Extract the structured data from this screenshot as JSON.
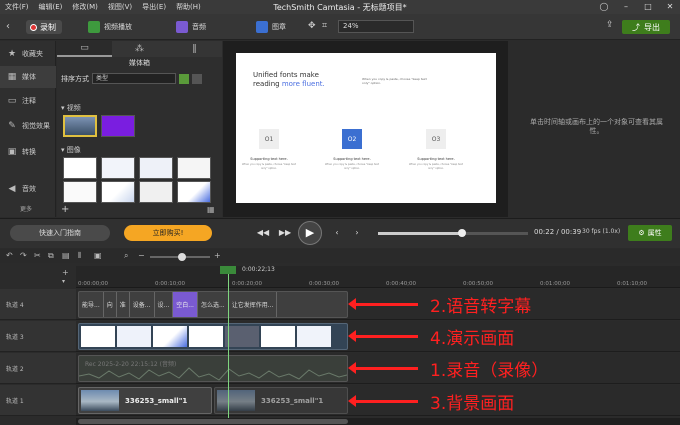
{
  "menubar": {
    "items": [
      "文件(F)",
      "编辑(E)",
      "修改(M)",
      "视图(V)",
      "导出(E)",
      "帮助(H)"
    ],
    "title": "TechSmith Camtasia - 无标题项目*"
  },
  "toolbar": {
    "record_label": "录制",
    "tools": [
      "视频播放",
      "音频",
      "图章"
    ],
    "zoom": "24%",
    "export_label": "导出"
  },
  "sidebar": {
    "items": [
      "收藏夹",
      "媒体",
      "注释",
      "视觉效果",
      "转换",
      "音效"
    ],
    "more_label": "更多"
  },
  "media": {
    "title": "媒体箱",
    "sort_label": "排序方式",
    "sort_value": "类型",
    "video_section": "视频",
    "image_section": "图像"
  },
  "slide": {
    "title_a": "Unified fonts make",
    "title_b": "reading",
    "title_blue": "more fluent.",
    "boxes": [
      "O1",
      "O2",
      "O3"
    ],
    "label": "Supporting text here.",
    "sub": "When you copy & paste, choose \"keep text only\" option."
  },
  "props": {
    "hint": "单击时间轴或画布上的一个对象可查看其属性。"
  },
  "controls": {
    "guide_label": "快速入门指南",
    "buy_label": "立即购买!",
    "time": "00:22 / 00:39",
    "fps": "30 fps (1.0x)",
    "progress": 0.56,
    "props_label": "属性"
  },
  "timeline": {
    "playhead_time": "0:00:22;13",
    "ruler": [
      "0:00:00;00",
      "0:00:10;00",
      "0:00:20;00",
      "0:00:30;00",
      "0:00:40;00",
      "0:00:50;00",
      "0:01:00;00",
      "0:01:10;00"
    ],
    "tracks": [
      "轨道 4",
      "轨道 3",
      "轨道 2",
      "轨道 1"
    ],
    "captions": [
      "能导...",
      "向",
      "准",
      "设备...",
      "设...",
      "空白...",
      "怎么选...",
      "让它发挥作用..."
    ],
    "audio_label": "Rec 2025-2-20 22:15:12 (音频)",
    "bg_clip_a": "336253_small\"1",
    "bg_clip_b": "336253_small\"1"
  },
  "annotations": [
    "2.语音转字幕",
    "4.演示画面",
    "1.录音（录像）",
    "3.背景画面"
  ],
  "colors": {
    "accent_green": "#3e7d1c",
    "buy_orange": "#f5a623",
    "annotation_red": "#ff2020",
    "selection_purple": "#7a5ad1"
  }
}
